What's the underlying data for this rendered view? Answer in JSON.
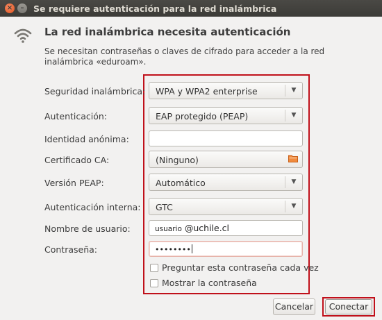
{
  "window": {
    "title": "Se requiere autenticación para la red inalámbrica",
    "close_glyph": "×",
    "minimize_glyph": "–"
  },
  "header": {
    "icon": "wifi-icon",
    "heading": "La red inalámbrica necesita autenticación",
    "description": "Se necesitan contraseñas o claves de cifrado para acceder a la red inalámbrica «eduroam»."
  },
  "form": {
    "security": {
      "label": "Seguridad inalámbrica:",
      "value": "WPA y WPA2 enterprise"
    },
    "authentication": {
      "label": "Autenticación:",
      "value": "EAP protegido (PEAP)"
    },
    "anonymous_identity": {
      "label": "Identidad anónima:",
      "value": ""
    },
    "ca_certificate": {
      "label": "Certificado CA:",
      "value": "(Ninguno)"
    },
    "peap_version": {
      "label": "Versión PEAP:",
      "value": "Automático"
    },
    "inner_authentication": {
      "label": "Autenticación interna:",
      "value": "GTC"
    },
    "username": {
      "label": "Nombre de usuario:",
      "value_prefix": "usuario",
      "value_domain": "@uchile.cl"
    },
    "password": {
      "label": "Contraseña:",
      "value": "••••••••"
    },
    "ask_password": {
      "label": "Preguntar esta contraseña cada vez",
      "checked": false
    },
    "show_password": {
      "label": "Mostrar la contraseña",
      "checked": false
    }
  },
  "buttons": {
    "cancel": "Cancelar",
    "connect": "Conectar"
  },
  "colors": {
    "highlight": "#c0101a",
    "titlebar": "#3c3b37",
    "close_button": "#e0531f"
  }
}
